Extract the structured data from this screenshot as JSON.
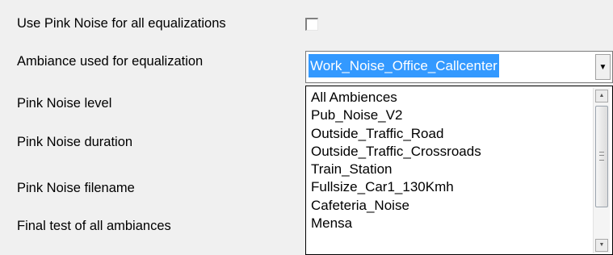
{
  "settings": {
    "pink_noise_all_label": "Use Pink Noise for all equalizations",
    "pink_noise_all_checked": false,
    "ambiance_label": "Ambiance used for equalization",
    "pink_noise_level_label": "Pink Noise level",
    "pink_noise_duration_label": "Pink Noise duration",
    "pink_noise_filename_label": "Pink Noise filename",
    "final_test_label": "Final test of all ambiances"
  },
  "ambiance_combo": {
    "selected": "Work_Noise_Office_Callcenter",
    "options": [
      "All Ambiences",
      "Pub_Noise_V2",
      "Outside_Traffic_Road",
      "Outside_Traffic_Crossroads",
      "Train_Station",
      "Fullsize_Car1_130Kmh",
      "Cafeteria_Noise",
      "Mensa"
    ]
  },
  "icons": {
    "dropdown_arrow": "chevron-down-icon",
    "scroll_up": "scroll-up-arrow-icon",
    "scroll_down": "scroll-down-arrow-icon"
  },
  "colors": {
    "background": "#f0f0f0",
    "selection": "#3399ff",
    "selection_text": "#ffffff"
  }
}
